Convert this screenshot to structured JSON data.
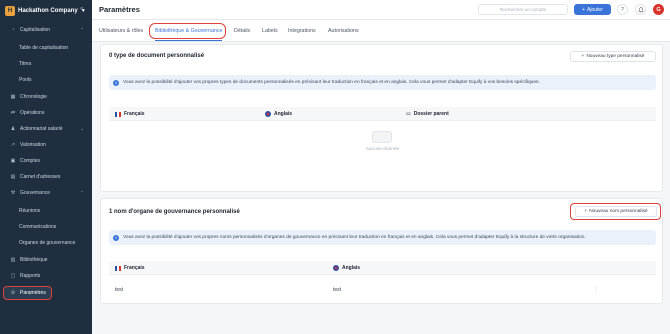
{
  "brand": {
    "logo_letter": "H",
    "name": "Hackathon Company"
  },
  "sidebar": {
    "items": [
      {
        "label": "Capitalisation",
        "icon": "pie-chart-icon",
        "expanded": true
      },
      {
        "label": "Table de capitalisation"
      },
      {
        "label": "Titres"
      },
      {
        "label": "Pools"
      },
      {
        "label": "Chronologie",
        "icon": "calendar-icon"
      },
      {
        "label": "Opérations",
        "icon": "swap-icon"
      },
      {
        "label": "Actionnariat salarié",
        "icon": "users-icon",
        "expanded": false
      },
      {
        "label": "Valorisation",
        "icon": "trend-icon"
      },
      {
        "label": "Comptes",
        "icon": "bank-icon"
      },
      {
        "label": "Carnet d'adresses",
        "icon": "address-book-icon"
      },
      {
        "label": "Gouvernance",
        "icon": "gavel-icon",
        "expanded": true
      },
      {
        "label": "Réunions"
      },
      {
        "label": "Communications"
      },
      {
        "label": "Organes de gouvernance"
      },
      {
        "label": "Bibliothèque",
        "icon": "book-icon"
      },
      {
        "label": "Rapports",
        "icon": "report-icon"
      },
      {
        "label": "Paramètres",
        "icon": "gear-icon",
        "active": true
      }
    ]
  },
  "header": {
    "title": "Paramètres",
    "search_placeholder": "Rechercher un compte",
    "add_label": "Ajouter",
    "help_symbol": "?",
    "avatar_initial": "G"
  },
  "tabs": [
    {
      "label": "Utilisateurs & rôles"
    },
    {
      "label": "Bibliothèque & Gouvernance",
      "active": true
    },
    {
      "label": "Détails"
    },
    {
      "label": "Labels"
    },
    {
      "label": "Integrations"
    },
    {
      "label": "Autorisations"
    }
  ],
  "doc_types": {
    "title": "0 type de document personnalisé",
    "new_button": "Nouveau type personnalisé",
    "info": "Vous avez la possibilité d'ajouter vos propres types de documents personnalisés en précisant leur traduction en français et en anglais. Cela vous permet d'adapter Equify à vos besoins spécifiques.",
    "columns": [
      "Français",
      "Anglais",
      "Dossier parent"
    ],
    "empty_text": "Aucune donnée"
  },
  "governance": {
    "title": "1 nom d'organe de gouvernance personnalisé",
    "new_button": "Nouveau nom personnalisé",
    "info": "Vous avez la possibilité d'ajouter vos propres noms personnalisés d'organes de gouvernance en précisant leur traduction en français et en anglais. Cela vous permet d'adapter Equify à la structure de votre organisation.",
    "columns": [
      "Français",
      "Anglais"
    ],
    "rows": [
      {
        "fr": "test",
        "en": "test"
      }
    ]
  },
  "colors": {
    "accent": "#3a74d9",
    "sidebar": "#1f2f40",
    "highlight": "#e0413a"
  }
}
